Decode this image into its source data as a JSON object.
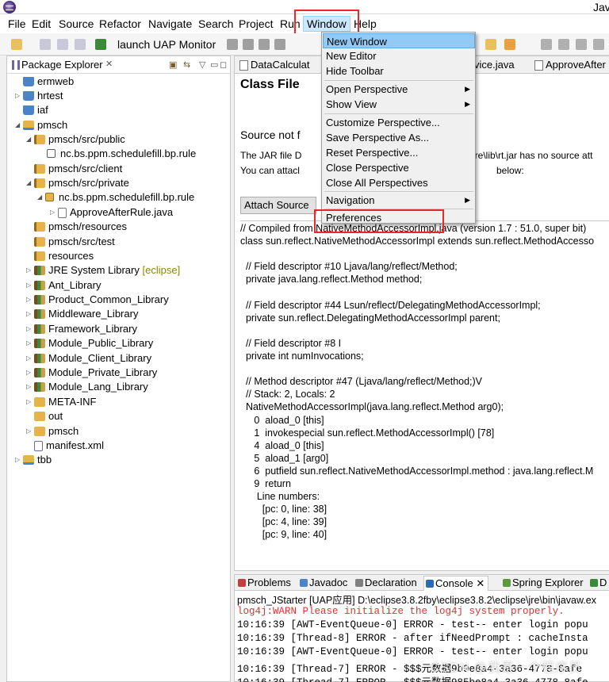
{
  "window": {
    "title": "Jav"
  },
  "menubar": [
    "File",
    "Edit",
    "Source",
    "Refactor",
    "Navigate",
    "Search",
    "Project",
    "Run",
    "Window",
    "Help"
  ],
  "toolbar": {
    "launch_label": "launch UAP Monitor"
  },
  "package_explorer": {
    "title": "Package Explorer",
    "items": [
      {
        "label": "ermweb",
        "icon": "project-icon",
        "deco": ""
      },
      {
        "label": "hrtest",
        "icon": "project-icon",
        "deco": ""
      },
      {
        "label": "iaf",
        "icon": "project-icon",
        "deco": ""
      },
      {
        "label": "pmsch",
        "icon": "project-open-icon",
        "deco": ""
      },
      {
        "label": "pmsch/src/public",
        "icon": "source-folder-icon",
        "deco": ""
      },
      {
        "label": "nc.bs.ppm.schedulefill.bp.rule",
        "icon": "package-icon",
        "deco": ""
      },
      {
        "label": "pmsch/src/client",
        "icon": "source-folder-icon",
        "deco": ""
      },
      {
        "label": "pmsch/src/private",
        "icon": "source-folder-icon",
        "deco": ""
      },
      {
        "label": "nc.bs.ppm.schedulefill.bp.rule",
        "icon": "package-open-icon",
        "deco": ""
      },
      {
        "label": "ApproveAfterRule.java",
        "icon": "java-file-icon",
        "deco": ""
      },
      {
        "label": "pmsch/resources",
        "icon": "source-folder-icon",
        "deco": ""
      },
      {
        "label": "pmsch/src/test",
        "icon": "source-folder-icon",
        "deco": ""
      },
      {
        "label": "resources",
        "icon": "source-folder-icon",
        "deco": ""
      },
      {
        "label": "JRE System Library",
        "icon": "library-icon",
        "deco": "[eclipse]"
      },
      {
        "label": "Ant_Library",
        "icon": "library-icon",
        "deco": ""
      },
      {
        "label": "Product_Common_Library",
        "icon": "library-icon",
        "deco": ""
      },
      {
        "label": "Middleware_Library",
        "icon": "library-icon",
        "deco": ""
      },
      {
        "label": "Framework_Library",
        "icon": "library-icon",
        "deco": ""
      },
      {
        "label": "Module_Public_Library",
        "icon": "library-icon",
        "deco": ""
      },
      {
        "label": "Module_Client_Library",
        "icon": "library-icon",
        "deco": ""
      },
      {
        "label": "Module_Private_Library",
        "icon": "library-icon",
        "deco": ""
      },
      {
        "label": "Module_Lang_Library",
        "icon": "library-icon",
        "deco": ""
      },
      {
        "label": "META-INF",
        "icon": "folder-icon",
        "deco": ""
      },
      {
        "label": "out",
        "icon": "folder-icon",
        "deco": ""
      },
      {
        "label": "pmsch",
        "icon": "folder-icon",
        "deco": ""
      },
      {
        "label": "manifest.xml",
        "icon": "xml-file-icon",
        "deco": ""
      },
      {
        "label": "tbb",
        "icon": "project-icon",
        "deco": ""
      }
    ]
  },
  "editor": {
    "tabs": [
      "DataCalculat",
      "vice.java",
      "ApproveAfter"
    ],
    "heading": "Class File",
    "source_not_found": "Source not f",
    "jar_line_1": "The JAR file D",
    "jar_line_1_right": "jre\\lib\\rt.jar has no source att",
    "jar_line_2": "You can attacl",
    "jar_line_2_right": "below:",
    "attach_button": "Attach Source",
    "code_lines": [
      "// Compiled from NativeMethodAccessorImpl.java (version 1.7 : 51.0, super bit)",
      "class sun.reflect.NativeMethodAccessorImpl extends sun.reflect.MethodAccesso",
      "",
      "  // Field descriptor #10 Ljava/lang/reflect/Method;",
      "  private java.lang.reflect.Method method;",
      "",
      "  // Field descriptor #44 Lsun/reflect/DelegatingMethodAccessorImpl;",
      "  private sun.reflect.DelegatingMethodAccessorImpl parent;",
      "",
      "  // Field descriptor #8 I",
      "  private int numInvocations;",
      "",
      "  // Method descriptor #47 (Ljava/lang/reflect/Method;)V",
      "  // Stack: 2, Locals: 2",
      "  NativeMethodAccessorImpl(java.lang.reflect.Method arg0);",
      "     0  aload_0 [this]",
      "     1  invokespecial sun.reflect.MethodAccessorImpl() [78]",
      "     4  aload_0 [this]",
      "     5  aload_1 [arg0]",
      "     6  putfield sun.reflect.NativeMethodAccessorImpl.method : java.lang.reflect.M",
      "     9  return",
      "      Line numbers:",
      "        [pc: 0, line: 38]",
      "        [pc: 4, line: 39]",
      "        [pc: 9, line: 40]"
    ]
  },
  "window_menu": {
    "items": [
      {
        "label": "New Window",
        "submenu": false,
        "highlighted": true
      },
      {
        "label": "New Editor",
        "submenu": false,
        "highlighted": false
      },
      {
        "label": "Hide Toolbar",
        "submenu": false,
        "highlighted": false
      },
      {
        "label": "Open Perspective",
        "submenu": true,
        "highlighted": false
      },
      {
        "label": "Show View",
        "submenu": true,
        "highlighted": false
      },
      {
        "label": "Customize Perspective...",
        "submenu": false,
        "highlighted": false
      },
      {
        "label": "Save Perspective As...",
        "submenu": false,
        "highlighted": false
      },
      {
        "label": "Reset Perspective...",
        "submenu": false,
        "highlighted": false
      },
      {
        "label": "Close Perspective",
        "submenu": false,
        "highlighted": false
      },
      {
        "label": "Close All Perspectives",
        "submenu": false,
        "highlighted": false
      },
      {
        "label": "Navigation",
        "submenu": true,
        "highlighted": false
      },
      {
        "label": "Preferences",
        "submenu": false,
        "highlighted": false
      }
    ]
  },
  "bottom_panel": {
    "tabs": [
      "Problems",
      "Javadoc",
      "Declaration",
      "Console",
      "Spring Explorer",
      "D"
    ],
    "console_header": "pmsch_JStarter [UAP应用] D:\\eclipse3.8.2fby\\eclipse3.8.2\\eclipse\\jre\\bin\\javaw.ex",
    "console_lines": [
      {
        "text": "log4j:WARN Please initialize the log4j system properly.",
        "warn": true
      },
      {
        "text": "10:16:39 [AWT-EventQueue-0] ERROR - test-- enter login popu",
        "warn": false
      },
      {
        "text": "10:16:39 [Thread-8] ERROR - after ifNeedPrompt : cacheInsta",
        "warn": false
      },
      {
        "text": "10:16:39 [AWT-EventQueue-0] ERROR - test-- enter login popu",
        "warn": false
      },
      {
        "text": "10:16:39 [Thread-7] ERROR - $$$元数据9b9e8a4-3a36-4778-8afe",
        "warn": false
      },
      {
        "text": "10:16:39 [Thread-7] ERROR - $$$元数据985be8a4-3a36-4778-8afe",
        "warn": false
      }
    ],
    "watermark": "CSDN @我是一个程序员"
  },
  "colors": {
    "highlight_box": "#e8292a",
    "menu_hover": "#91c9f7",
    "warn_text": "#e03030"
  }
}
